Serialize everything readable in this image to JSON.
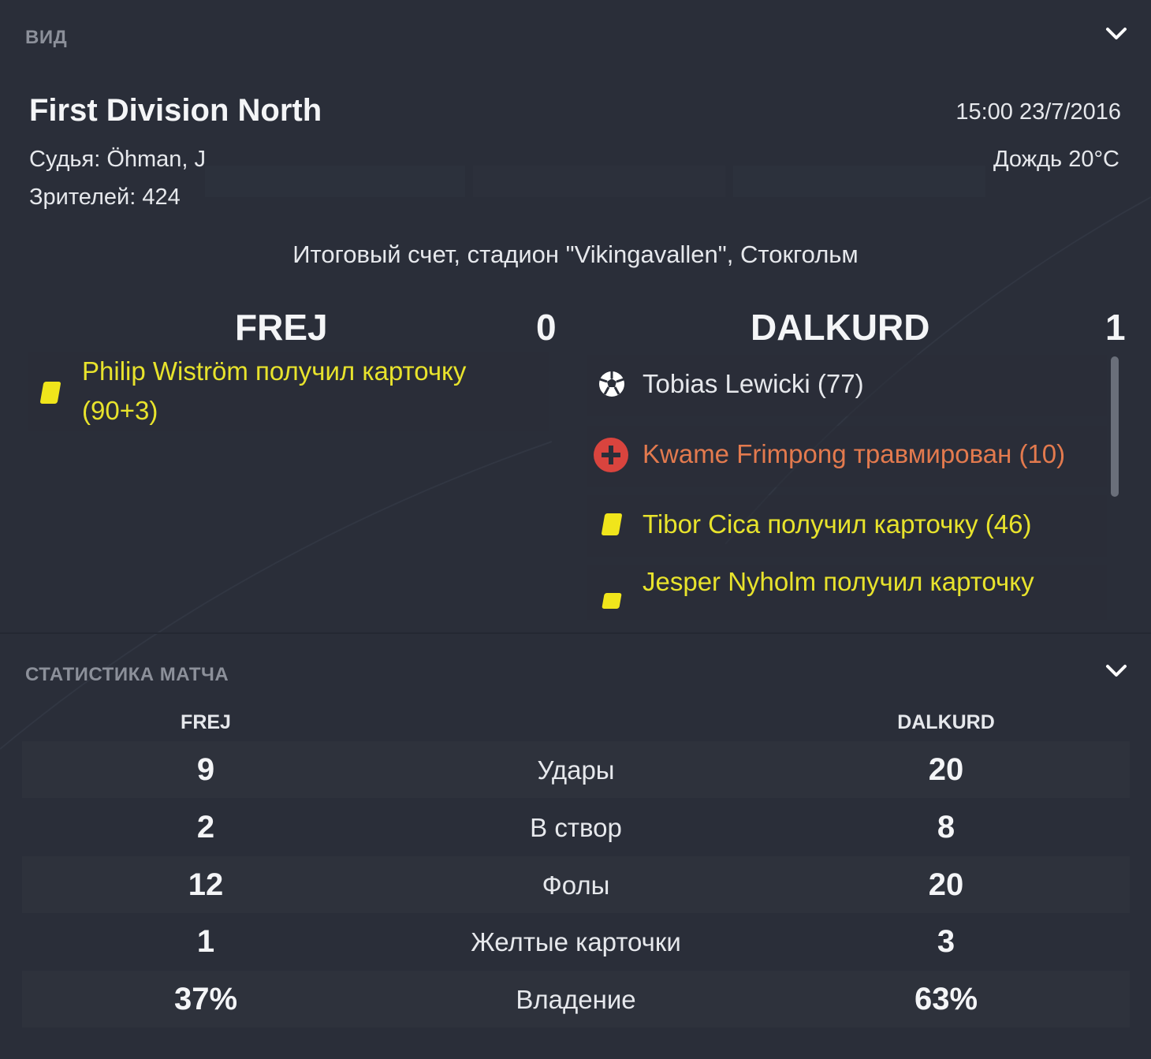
{
  "view_section": {
    "header": "ВИД",
    "competition": "First Division North",
    "datetime": "15:00 23/7/2016",
    "referee": "Судья: Öhman, J",
    "weather": "Дождь 20°C",
    "attendance": "Зрителей: 424",
    "result_line": "Итоговый счет, стадион \"Vikingavallen\", Стокгольм",
    "home_team": "FREJ",
    "home_score": "0",
    "away_team": "DALKURD",
    "away_score": "1",
    "home_events": [
      {
        "type": "yellow-card",
        "line1": "Philip Wiström получил карточку",
        "line2": "(90+3)"
      }
    ],
    "away_events": [
      {
        "type": "goal",
        "text": "Tobias Lewicki (77)"
      },
      {
        "type": "injury",
        "text": "Kwame Frimpong травмирован (10)"
      },
      {
        "type": "yellow-card",
        "text": "Tibor Cica получил карточку (46)"
      },
      {
        "type": "yellow-card",
        "text": "Jesper Nyholm получил карточку"
      }
    ]
  },
  "stats_section": {
    "header": "СТАТИСТИКА МАТЧА",
    "home_label": "FREJ",
    "away_label": "DALKURD",
    "rows": [
      {
        "label": "Удары",
        "home": "9",
        "away": "20"
      },
      {
        "label": "В створ",
        "home": "2",
        "away": "8"
      },
      {
        "label": "Фолы",
        "home": "12",
        "away": "20"
      },
      {
        "label": "Желтые карточки",
        "home": "1",
        "away": "3"
      },
      {
        "label": "Владение",
        "home": "37%",
        "away": "63%"
      }
    ]
  },
  "colors": {
    "background": "#2a2e39",
    "yellow_event": "#e8e32c",
    "injury_event": "#e37a4e",
    "injury_icon": "#d9443e"
  }
}
